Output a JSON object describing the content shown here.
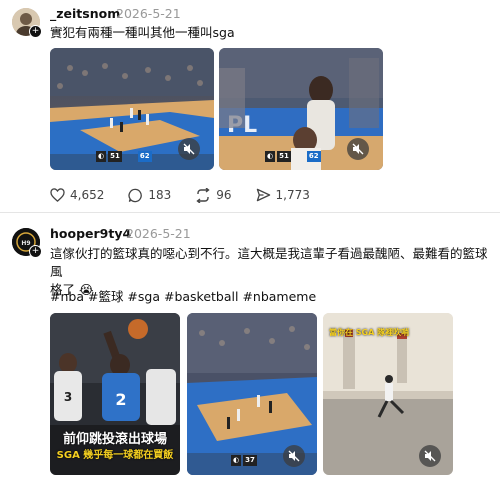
{
  "post1": {
    "username": "_zeitsnom",
    "timestamp": "2026-5-21",
    "text": "實犯有兩種一種叫其他一種叫sga",
    "video1": {
      "score_left": "51",
      "score_right": "62"
    },
    "video2": {
      "score_left": "51",
      "score_right": "62",
      "court_text": "PL"
    },
    "actions": {
      "likes": "4,652",
      "comments": "183",
      "reposts": "96",
      "shares": "1,773"
    }
  },
  "post2": {
    "username": "hooper9ty4",
    "timestamp": "2026-5-21",
    "text_line1": "這傢伙打的籃球真的噁心到不行。這大概是我這輩子看過最醜陋、最難看的籃球風",
    "text_line2": "格了 😭",
    "hashtags": "#nba #籃球 #sga #basketball #nbameme",
    "image1": {
      "caption_line1": "前仰跳投滾出球場",
      "caption_line2": "SGA 幾乎每一球都在買飯",
      "jersey_left": "3",
      "jersey_right": "2"
    },
    "video2": {
      "score_left": "37"
    },
    "image3": {
      "caption": "當你在 SGA 隊裡吹哨"
    }
  },
  "colors": {
    "background": "#ffffff",
    "text": "#111111",
    "muted": "#999999",
    "court_blue": "#1b6cc7",
    "caption_yellow": "#f5d020"
  },
  "icons": [
    "plus-icon",
    "mute-icon",
    "heart-icon",
    "comment-icon",
    "repost-icon",
    "share-icon"
  ]
}
